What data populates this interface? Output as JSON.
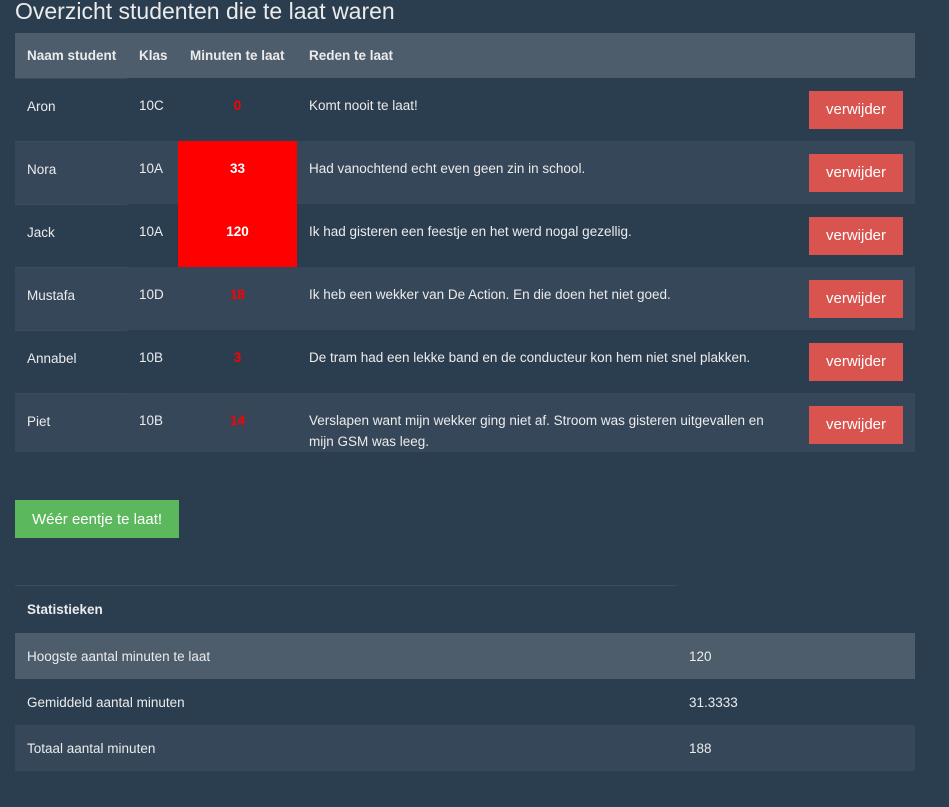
{
  "page": {
    "title": "Overzicht studenten die te laat waren"
  },
  "students_table": {
    "headers": {
      "name": "Naam student",
      "klas": "Klas",
      "minutes": "Minuten te laat",
      "reason": "Reden te laat"
    },
    "delete_label": "verwijder",
    "rows": [
      {
        "name": "Aron",
        "klas": "10C",
        "minutes": "0",
        "reason": "Komt nooit te laat!"
      },
      {
        "name": "Nora",
        "klas": "10A",
        "minutes": "33",
        "reason": "Had vanochtend echt even geen zin in school."
      },
      {
        "name": "Jack",
        "klas": "10A",
        "minutes": "120",
        "reason": "Ik had gisteren een feestje en het werd nogal gezellig."
      },
      {
        "name": "Mustafa",
        "klas": "10D",
        "minutes": "18",
        "reason": "Ik heb een wekker van De Action. En die doen het niet goed."
      },
      {
        "name": "Annabel",
        "klas": "10B",
        "minutes": "3",
        "reason": "De tram had een lekke band en de conducteur kon hem niet snel plakken."
      },
      {
        "name": "Piet",
        "klas": "10B",
        "minutes": "14",
        "reason": "Verslapen want mijn wekker ging niet af. Stroom was gisteren uitgevallen en mijn GSM was leeg."
      }
    ]
  },
  "add_button": {
    "label": "Wéér eentje te laat!"
  },
  "stats": {
    "header": "Statistieken",
    "rows": [
      {
        "label": "Hoogste aantal minuten te laat",
        "value": "120"
      },
      {
        "label": "Gemiddeld aantal minuten",
        "value": "31.3333"
      },
      {
        "label": "Totaal aantal minuten",
        "value": "188"
      }
    ]
  },
  "colors": {
    "background": "#2b3e50",
    "table_header": "#4e5d6c",
    "row_alt": "#354759",
    "late_highlight": "#ff0000",
    "delete_button": "#d9534f",
    "add_button": "#5cb85c"
  }
}
